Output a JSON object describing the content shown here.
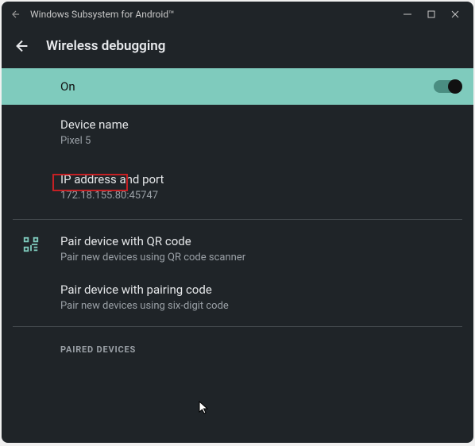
{
  "titlebar": {
    "title": "Windows Subsystem for Android™"
  },
  "header": {
    "title": "Wireless debugging"
  },
  "toggle": {
    "label": "On",
    "state": true
  },
  "device_name": {
    "title": "Device name",
    "value": "Pixel 5"
  },
  "ip_port": {
    "title": "IP address and port",
    "value": "172.18.155.80:45747"
  },
  "qr": {
    "title": "Pair device with QR code",
    "sub": "Pair new devices using QR code scanner"
  },
  "code": {
    "title": "Pair device with pairing code",
    "sub": "Pair new devices using six-digit code"
  },
  "paired": {
    "label": "PAIRED DEVICES"
  },
  "colors": {
    "accent": "#7fcbbd",
    "highlight": "#c42024"
  }
}
